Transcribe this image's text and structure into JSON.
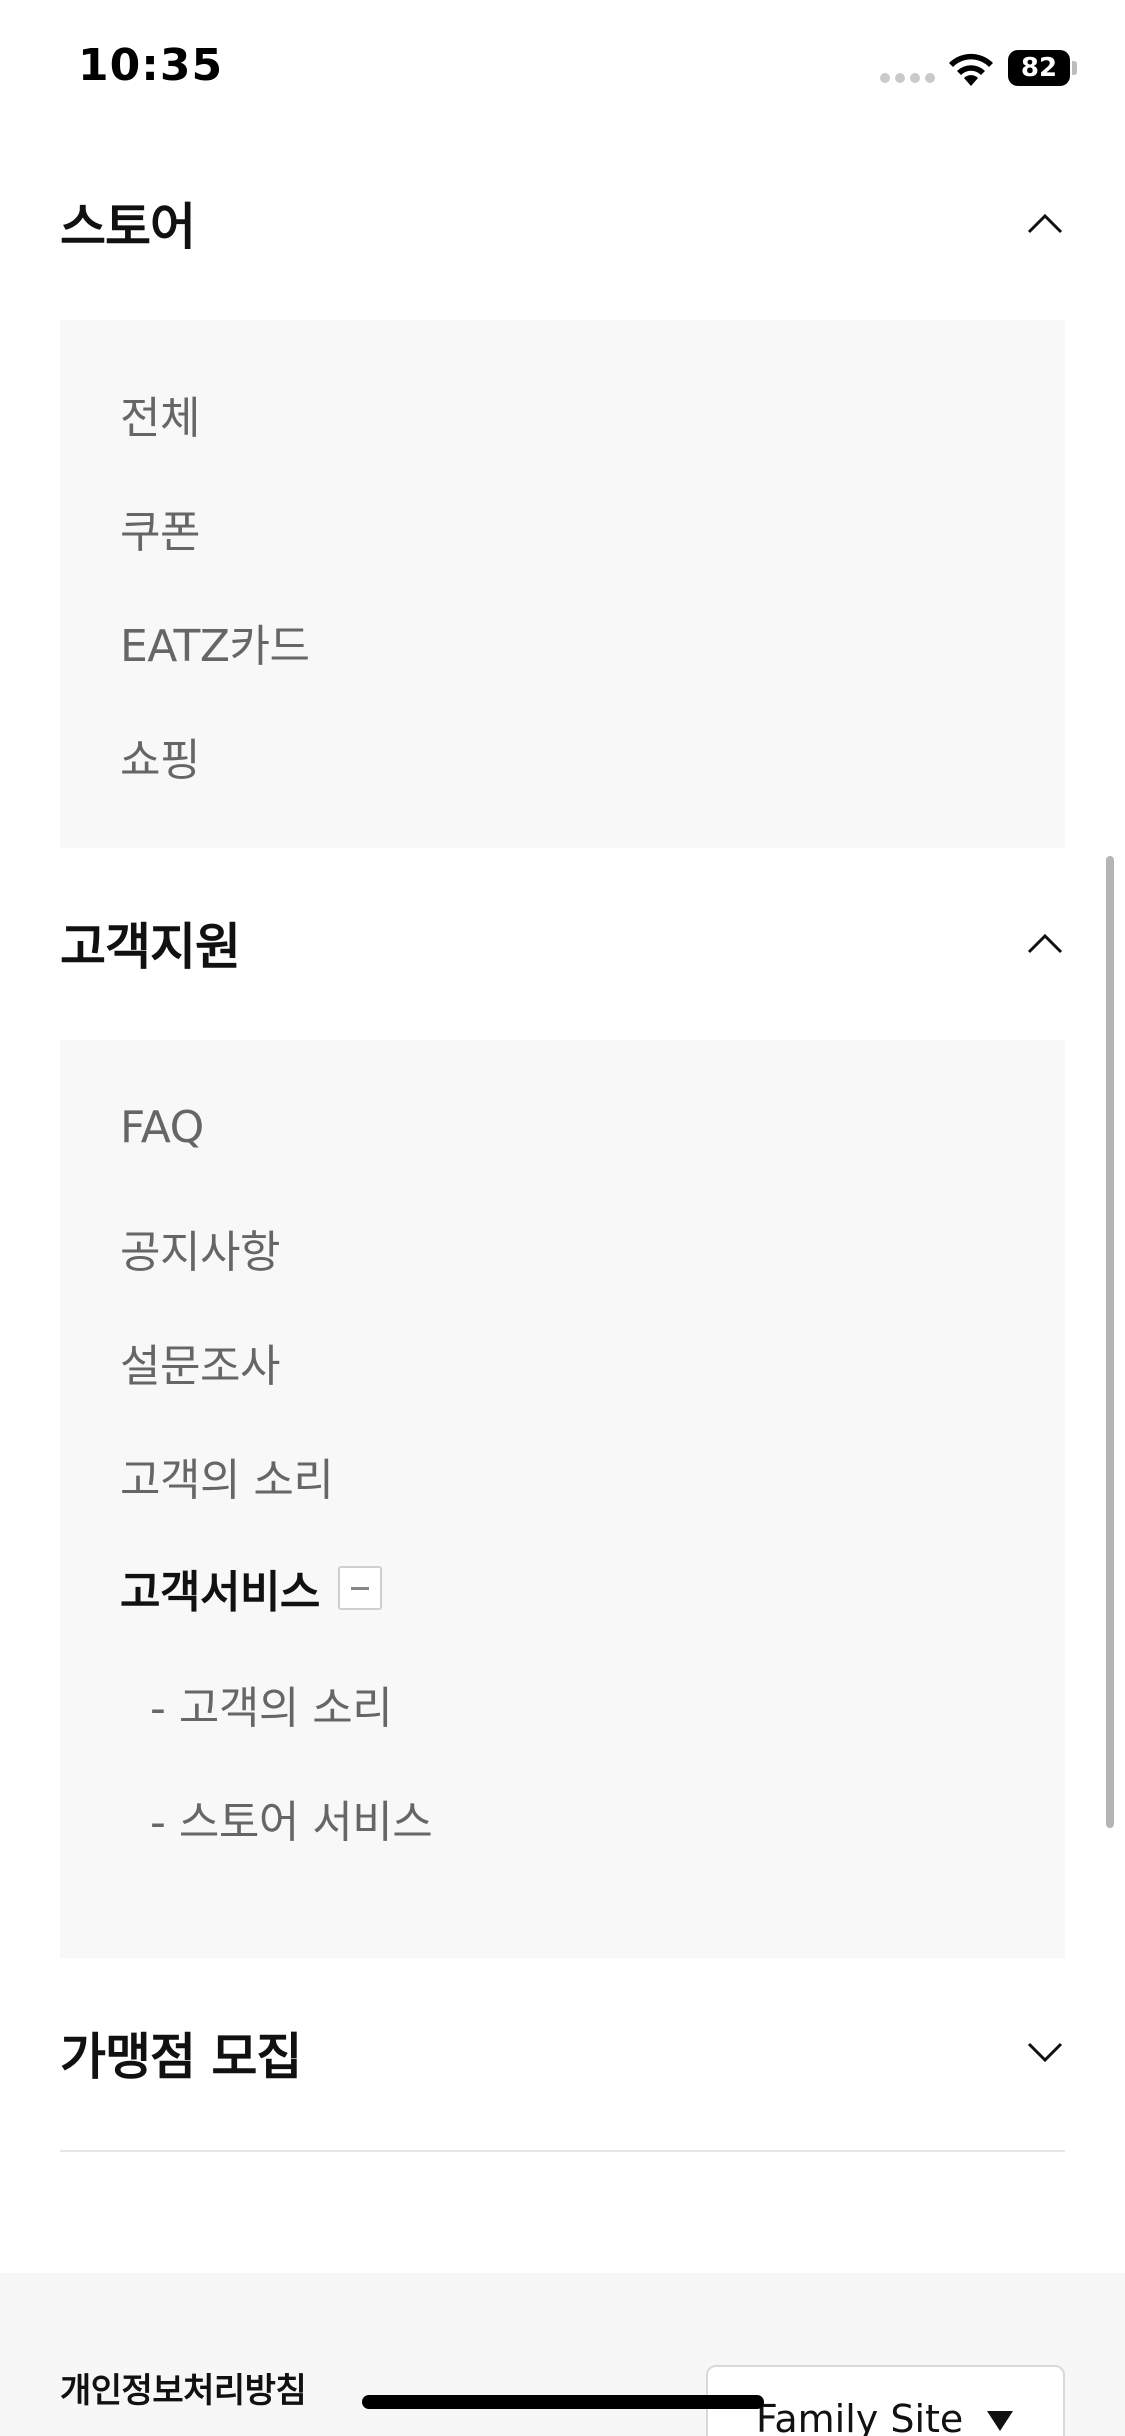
{
  "status_bar": {
    "time": "10:35",
    "battery": "82"
  },
  "sections": {
    "store": {
      "title": "스토어",
      "items": [
        "전체",
        "쿠폰",
        "EATZ카드",
        "쇼핑"
      ]
    },
    "support": {
      "title": "고객지원",
      "items": [
        "FAQ",
        "공지사항",
        "설문조사",
        "고객의 소리"
      ],
      "expanded_item": "고객서비스",
      "sub_items": [
        "- 고객의 소리",
        "- 스토어 서비스"
      ]
    },
    "franchise": {
      "title": "가맹점 모집"
    }
  },
  "footer": {
    "privacy_label": "개인정보처리방침",
    "family_site_label": "Family Site"
  },
  "icons": {
    "store_toggle": "chevron-up-icon",
    "support_toggle": "chevron-up-icon",
    "franchise_toggle": "chevron-down-icon",
    "service_toggle": "minus-icon"
  }
}
